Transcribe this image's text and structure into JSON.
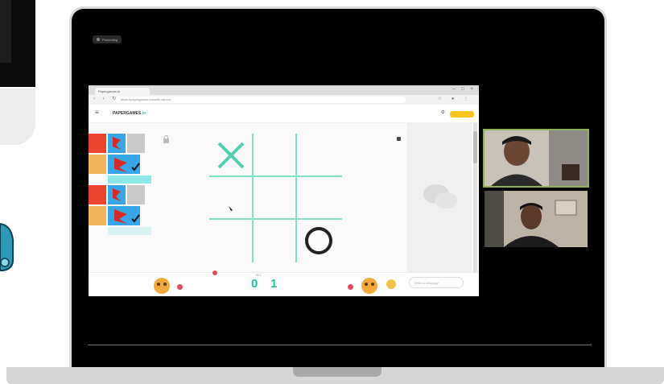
{
  "meet": {
    "presenting_label": "Presenting"
  },
  "browser": {
    "tab_title": "Papergames.io",
    "url": "https://papergames.io/en/tic-tac-toe"
  },
  "site": {
    "logo_main": "PAPERGAMES",
    "logo_suffix": ".io"
  },
  "game": {
    "score_left": "0",
    "score_right": "1",
    "score_header": "W   L",
    "chat_placeholder": "Write a message"
  },
  "colors": {
    "accent": "#19c5a1",
    "mark_x": "#4fd1b0",
    "board_line": "#7fe0c6",
    "gold": "#f7c51c",
    "speaker_border": "#8fb15a"
  }
}
